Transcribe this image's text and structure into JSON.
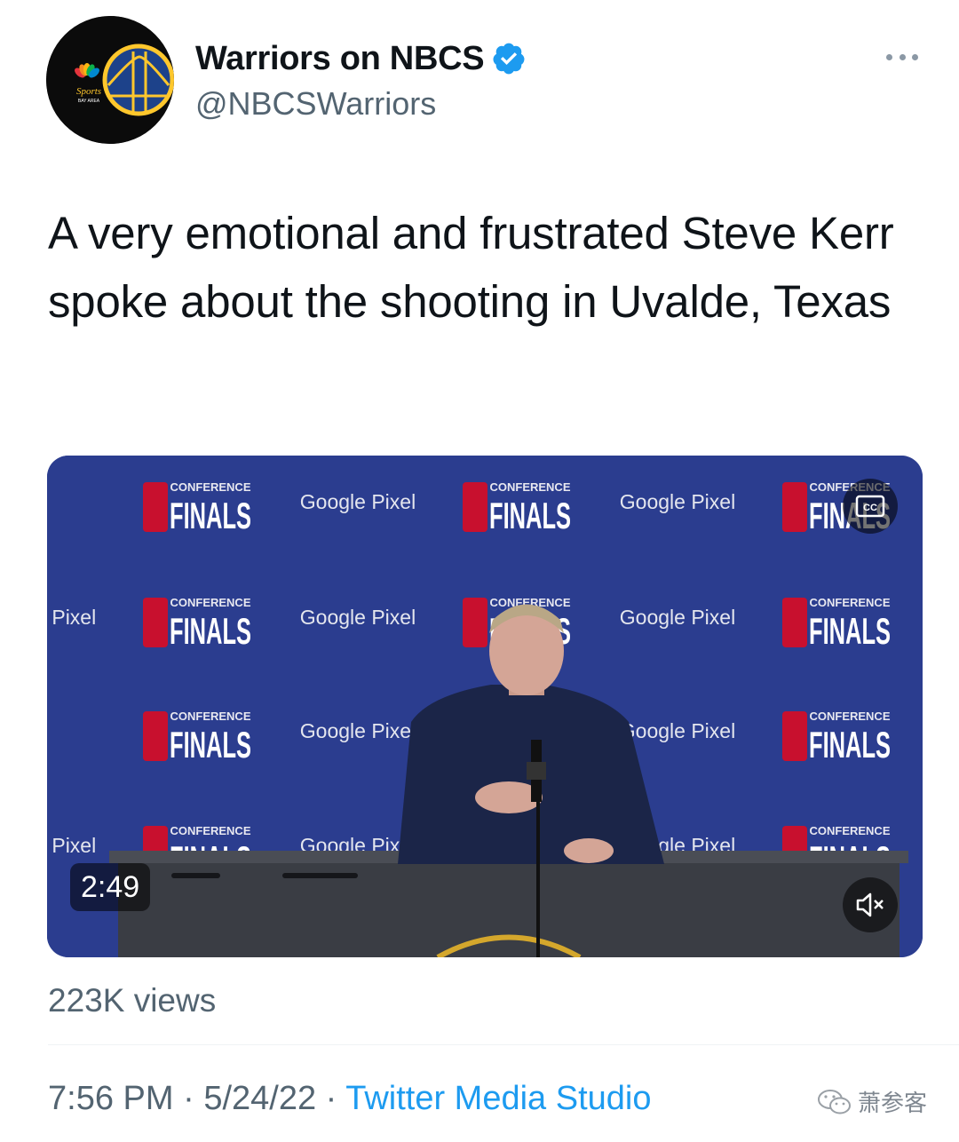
{
  "account": {
    "display_name": "Warriors on NBCS",
    "handle": "@NBCSWarriors",
    "verified": true,
    "avatar_text": "Sports BAY AREA"
  },
  "tweet": {
    "text": "A very emotional and frustrated Steve Kerr spoke about the shooting in Uvalde, Texas"
  },
  "video": {
    "duration": "2:49",
    "backdrop_repeat": {
      "sponsor": "Google Pixel",
      "event_top": "CONFERENCE",
      "event_bottom": "FINALS"
    },
    "cc_label": "CC"
  },
  "stats": {
    "views": "223K views"
  },
  "meta": {
    "time": "7:56 PM",
    "separator": " · ",
    "date": "5/24/22",
    "source": "Twitter Media Studio"
  },
  "watermark": {
    "text": "萧参客"
  },
  "colors": {
    "link_blue": "#1d9bf0",
    "muted_text": "#536471",
    "backdrop_blue": "#2b3d8f"
  }
}
